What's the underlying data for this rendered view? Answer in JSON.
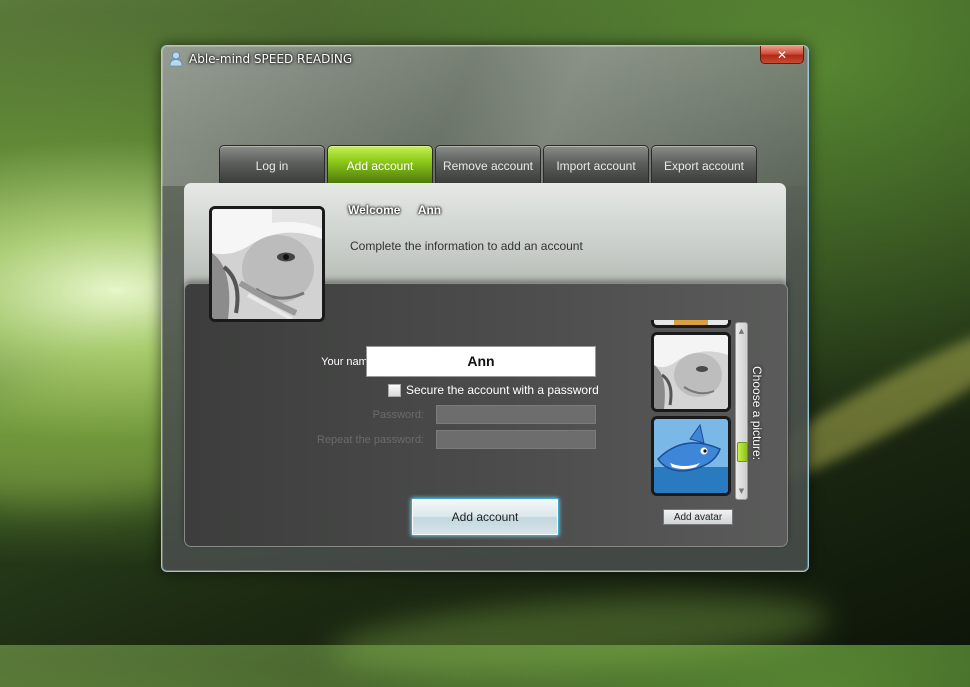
{
  "window": {
    "title": "Able-mind SPEED READING",
    "close_label": "✕"
  },
  "tabs": [
    {
      "label": "Log in",
      "active": false
    },
    {
      "label": "Add account",
      "active": true
    },
    {
      "label": "Remove account",
      "active": false
    },
    {
      "label": "Import account",
      "active": false
    },
    {
      "label": "Export account",
      "active": false
    }
  ],
  "header": {
    "welcome": "Welcome",
    "user_name": "Ann",
    "subtitle": "Complete the information to add an account"
  },
  "form": {
    "name_label": "Your name:",
    "name_value": "Ann",
    "secure_checkbox_label": "Secure the account with a password",
    "secure_checked": false,
    "password_label": "Password:",
    "repeat_password_label": "Repeat the password:",
    "submit_label": "Add account"
  },
  "avatar_picker": {
    "choose_label": "Choose a picture:",
    "add_avatar_label": "Add avatar",
    "items": [
      "girl-avatar-partial",
      "girl-avatar",
      "shark-avatar"
    ]
  },
  "colors": {
    "accent_green": "#8fcb1a",
    "button_focus": "#3aa7c8"
  }
}
